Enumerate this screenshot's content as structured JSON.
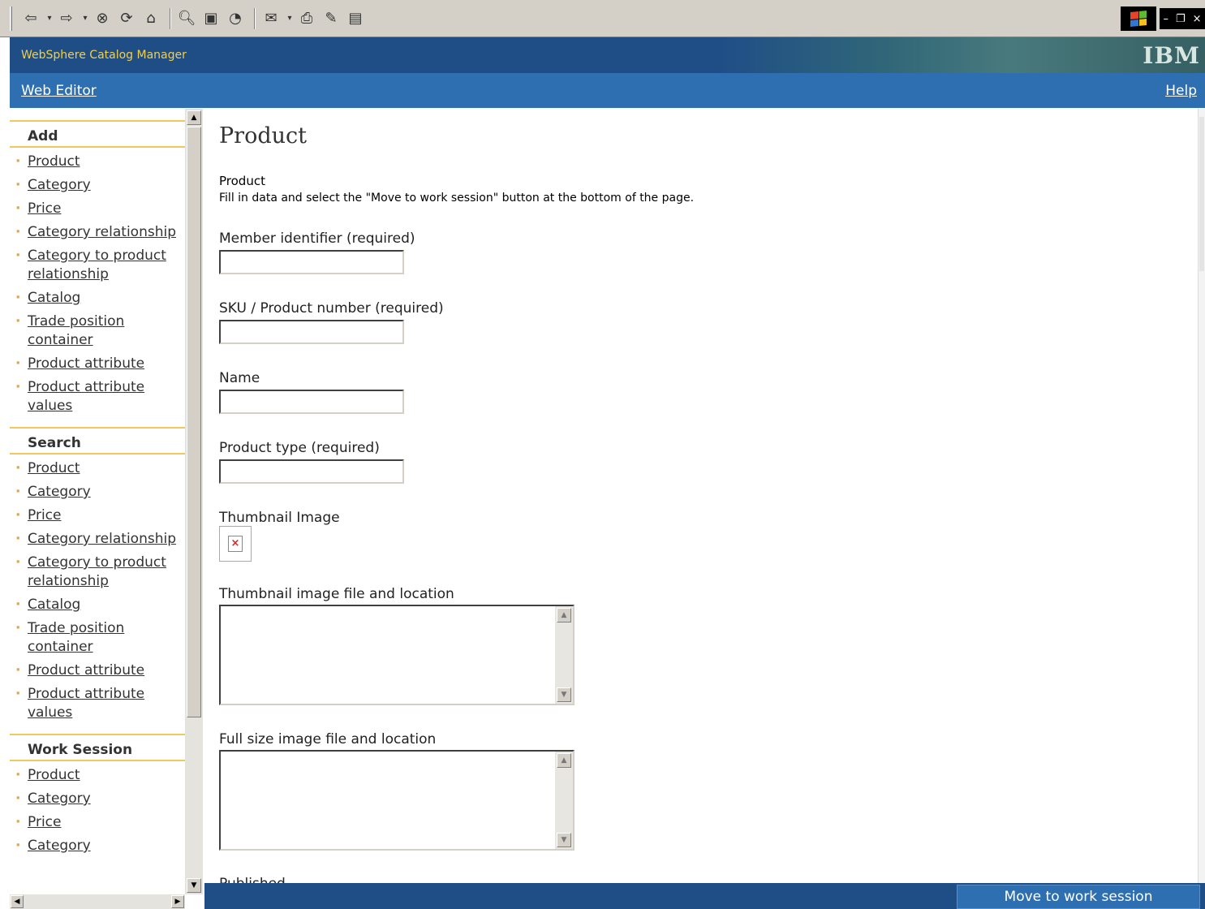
{
  "browser": {
    "toolbar_icons": [
      "back-arrow-icon",
      "forward-arrow-icon",
      "stop-icon",
      "refresh-icon",
      "home-icon",
      "search-icon",
      "favorites-icon",
      "history-icon",
      "mail-icon",
      "print-icon",
      "edit-icon",
      "discuss-icon"
    ]
  },
  "header": {
    "app_title": "WebSphere Catalog Manager",
    "logo": "IBM"
  },
  "nav": {
    "web_editor": "Web Editor",
    "help": "Help"
  },
  "sidebar": {
    "sections": [
      {
        "heading": "Add",
        "items": [
          "Product",
          "Category",
          "Price",
          "Category relationship",
          "Category to product relationship",
          "Catalog",
          "Trade position container",
          "Product attribute",
          "Product attribute values"
        ]
      },
      {
        "heading": "Search",
        "items": [
          "Product",
          "Category",
          "Price",
          "Category relationship",
          "Category to product relationship",
          "Catalog",
          "Trade position container",
          "Product attribute",
          "Product attribute values"
        ]
      },
      {
        "heading": "Work Session",
        "items": [
          "Product",
          "Category",
          "Price",
          "Category"
        ]
      }
    ]
  },
  "main": {
    "title": "Product",
    "subhead": "Product",
    "instructions": "Fill in data and select the \"Move to work session\" button at the bottom of the page.",
    "fields": {
      "member_identifier": {
        "label": "Member identifier (required)",
        "value": ""
      },
      "sku": {
        "label": "SKU / Product number (required)",
        "value": ""
      },
      "name": {
        "label": "Name",
        "value": ""
      },
      "product_type": {
        "label": "Product type (required)",
        "value": ""
      },
      "thumbnail_image": {
        "label": "Thumbnail Image"
      },
      "thumbnail_file": {
        "label": "Thumbnail image file and location",
        "value": ""
      },
      "fullsize_file": {
        "label": "Full size image file and location",
        "value": ""
      },
      "published": {
        "label": "Published"
      }
    },
    "move_button": "Move to work session"
  },
  "colors": {
    "header_bg": "#1f4e87",
    "nav_bg": "#2e6fb1",
    "title_yellow": "#f2cf4a",
    "section_rule": "#f2c75c"
  }
}
